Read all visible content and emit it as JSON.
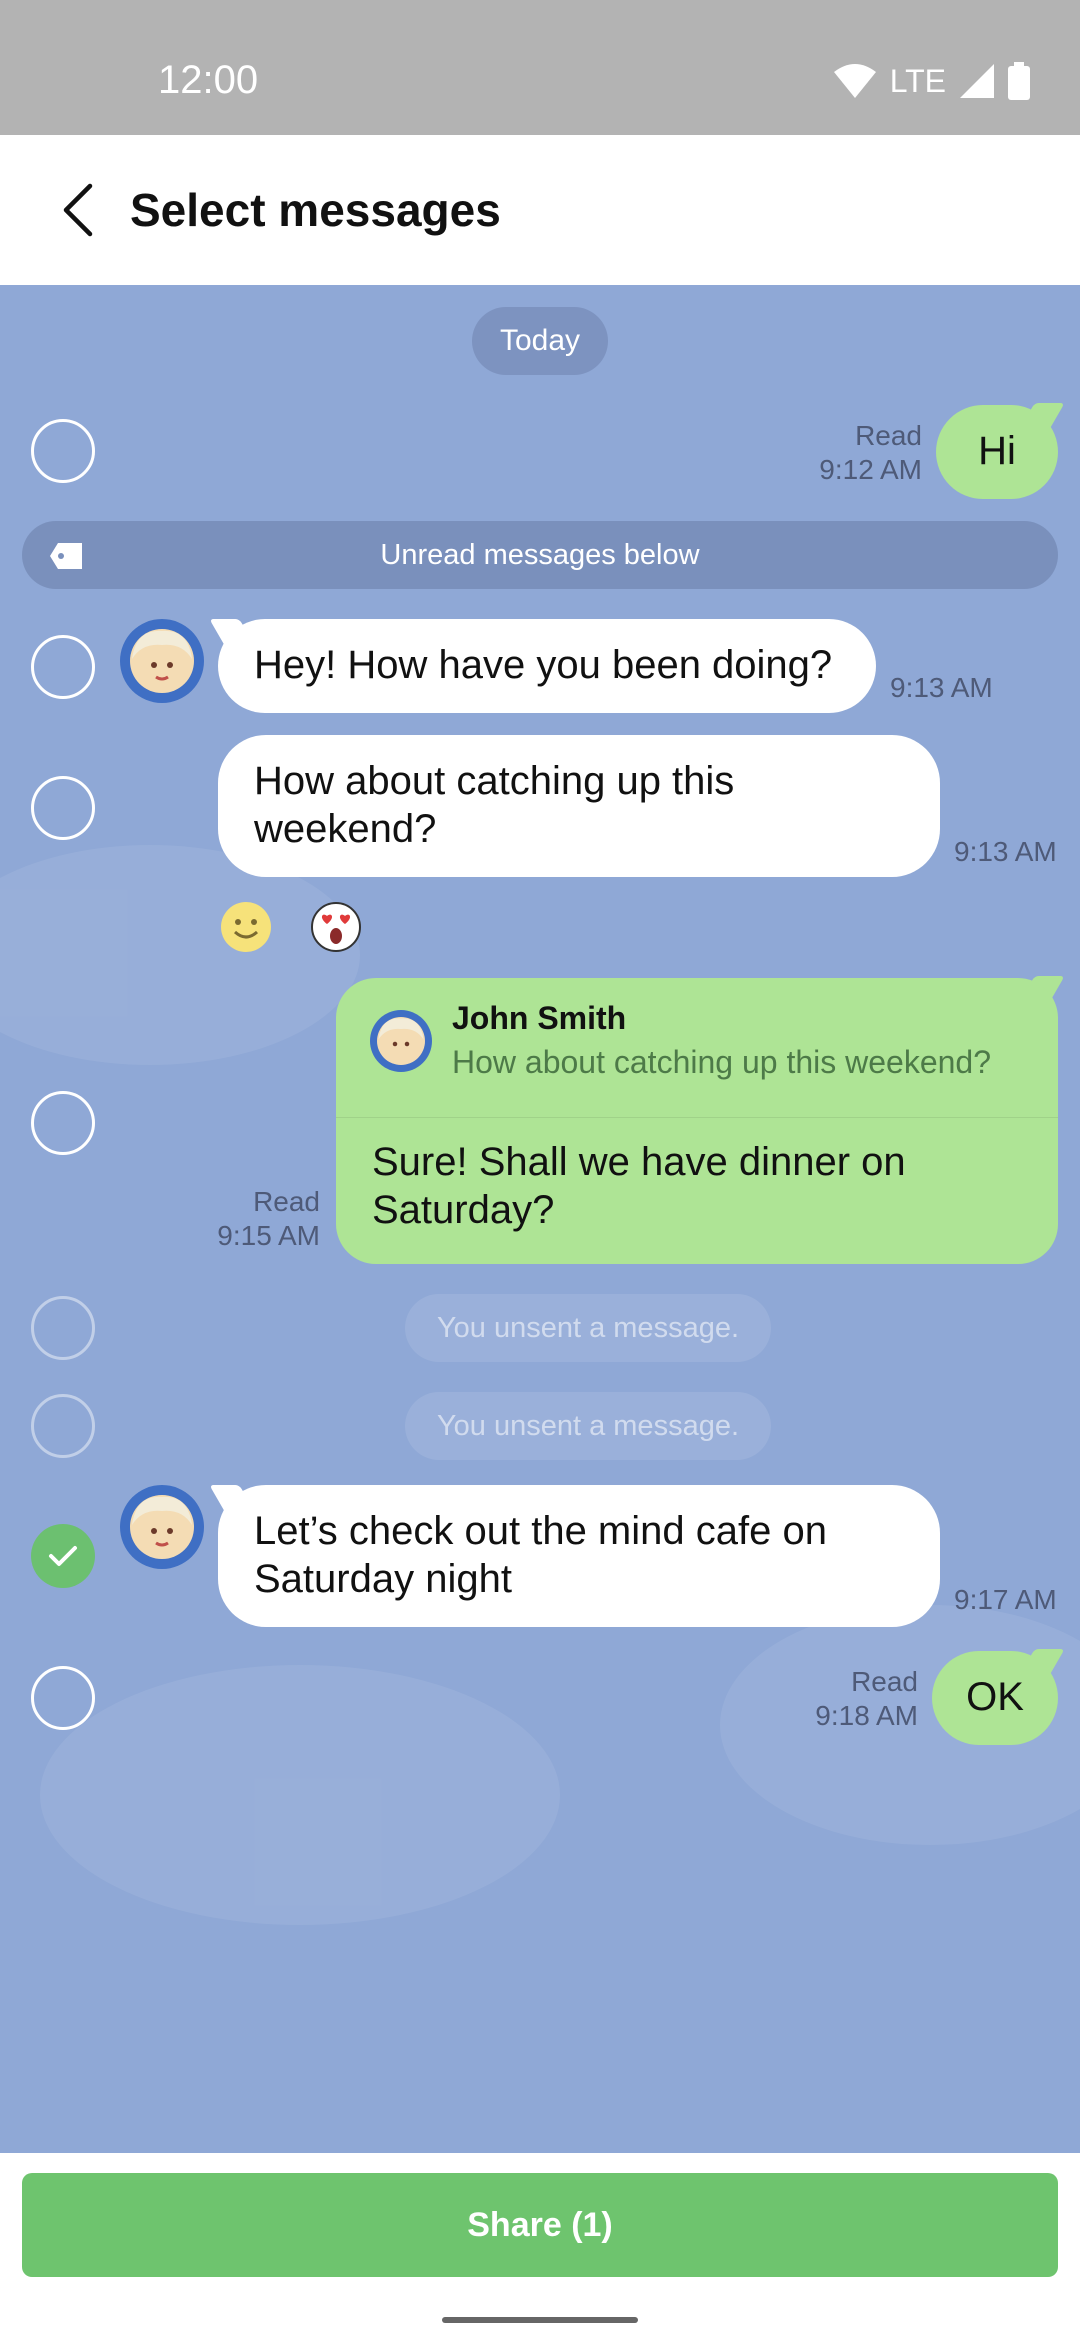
{
  "status_bar": {
    "time": "12:00",
    "network": "LTE"
  },
  "header": {
    "title": "Select messages"
  },
  "chat": {
    "date_pill": "Today",
    "unread_divider": "Unread messages below",
    "messages": [
      {
        "text": "Hi",
        "read": "Read",
        "time": "9:12 AM"
      },
      {
        "text": "Hey! How have you been doing?",
        "time": "9:13 AM"
      },
      {
        "text": "How about catching up this weekend?",
        "time": "9:13 AM"
      },
      {
        "reply_name": "John Smith",
        "reply_quote": "How about catching up this weekend?",
        "text": "Sure! Shall we have dinner on Saturday?",
        "read": "Read",
        "time": "9:15 AM"
      },
      {
        "text": "You unsent a message."
      },
      {
        "text": "You unsent a message."
      },
      {
        "text": "Let’s check out the mind cafe on Saturday night",
        "time": "9:17 AM",
        "selected": true
      },
      {
        "text": "OK",
        "read": "Read",
        "time": "9:18 AM"
      }
    ]
  },
  "footer": {
    "share_label": "Share (1)"
  },
  "colors": {
    "chat_bg": "#8fa8d6",
    "outgoing": "#aee495",
    "accent": "#6ec46e"
  }
}
